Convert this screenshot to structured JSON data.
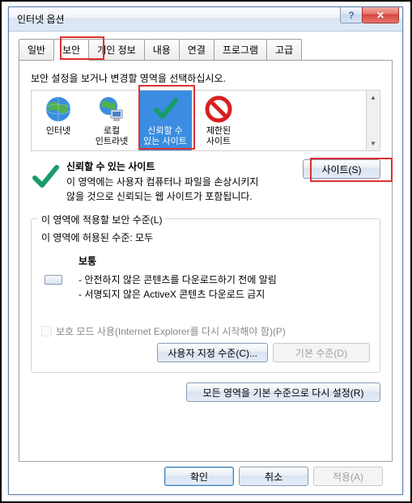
{
  "window": {
    "title": "인터넷 옵션"
  },
  "tabs": {
    "general": "일반",
    "security": "보안",
    "privacy": "개인 정보",
    "content": "내용",
    "connections": "연결",
    "programs": "프로그램",
    "advanced": "고급"
  },
  "security": {
    "instruction": "보안 설정을 보거나 변경할 영역을 선택하십시오.",
    "zones": {
      "internet": "인터넷",
      "intranet1": "로컬",
      "intranet2": "인트라넷",
      "trusted1": "신뢰할 수",
      "trusted2": "있는 사이트",
      "restricted1": "제한된",
      "restricted2": "사이트"
    },
    "desc": {
      "title": "신뢰할 수 있는 사이트",
      "line1": "이 영역에는 사용자 컴퓨터나 파일을 손상시키지",
      "line2": "않을 것으로 신뢰되는 웹 사이트가 포함됩니다."
    },
    "sites_btn": "사이트(S)",
    "group_title": "이 영역에 적용할 보안 수준(L)",
    "allowed": "이 영역에 허용된 수준: 모두",
    "level_name": "보통",
    "bullet1": "- 안전하지 않은 콘텐츠를 다운로드하기 전에 알림",
    "bullet2": "- 서명되지 않은 ActiveX 콘텐츠 다운로드 금지",
    "protected_mode": "보호 모드 사용(Internet Explorer를 다시 시작해야 함)(P)",
    "custom_btn": "사용자 지정 수준(C)...",
    "default_btn": "기본 수준(D)",
    "reset_btn": "모든 영역을 기본 수준으로 다시 설정(R)"
  },
  "dialog": {
    "ok": "확인",
    "cancel": "취소",
    "apply": "적용(A)"
  }
}
